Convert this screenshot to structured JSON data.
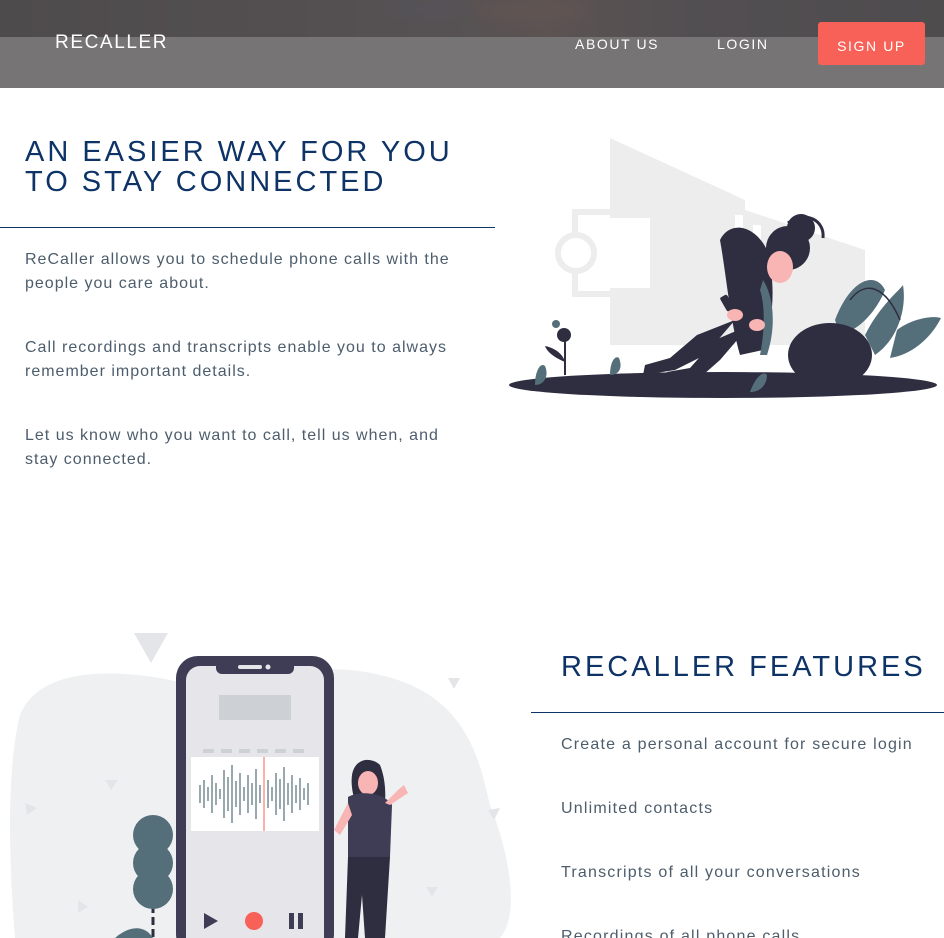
{
  "header": {
    "brand": "RECALLER",
    "nav": {
      "about": "ABOUT US",
      "login": "LOGIN",
      "signup": "SIGN UP"
    },
    "signup_color": "#f86157"
  },
  "intro": {
    "heading_line1": "AN EASIER WAY FOR YOU",
    "heading_line2": "TO STAY CONNECTED",
    "paragraphs": [
      "ReCaller allows you to schedule phone calls with the people you care about.",
      "Call recordings and transcripts enable you to always remember important details.",
      "Let us know who you want to call, tell us when, and stay connected."
    ]
  },
  "features": {
    "heading": "RECALLER FEATURES",
    "items": [
      "Create a personal account for secure login",
      "Unlimited contacts",
      "Transcripts of all your conversations",
      "Recordings of all phone calls"
    ]
  },
  "colors": {
    "heading": "#0e3366",
    "body_text": "#4d5d6c",
    "accent": "#f86157",
    "illustration_dark": "#2f2e41",
    "illustration_teal": "#546e7a"
  },
  "icons": [
    "play-icon",
    "record-icon",
    "pause-icon"
  ]
}
